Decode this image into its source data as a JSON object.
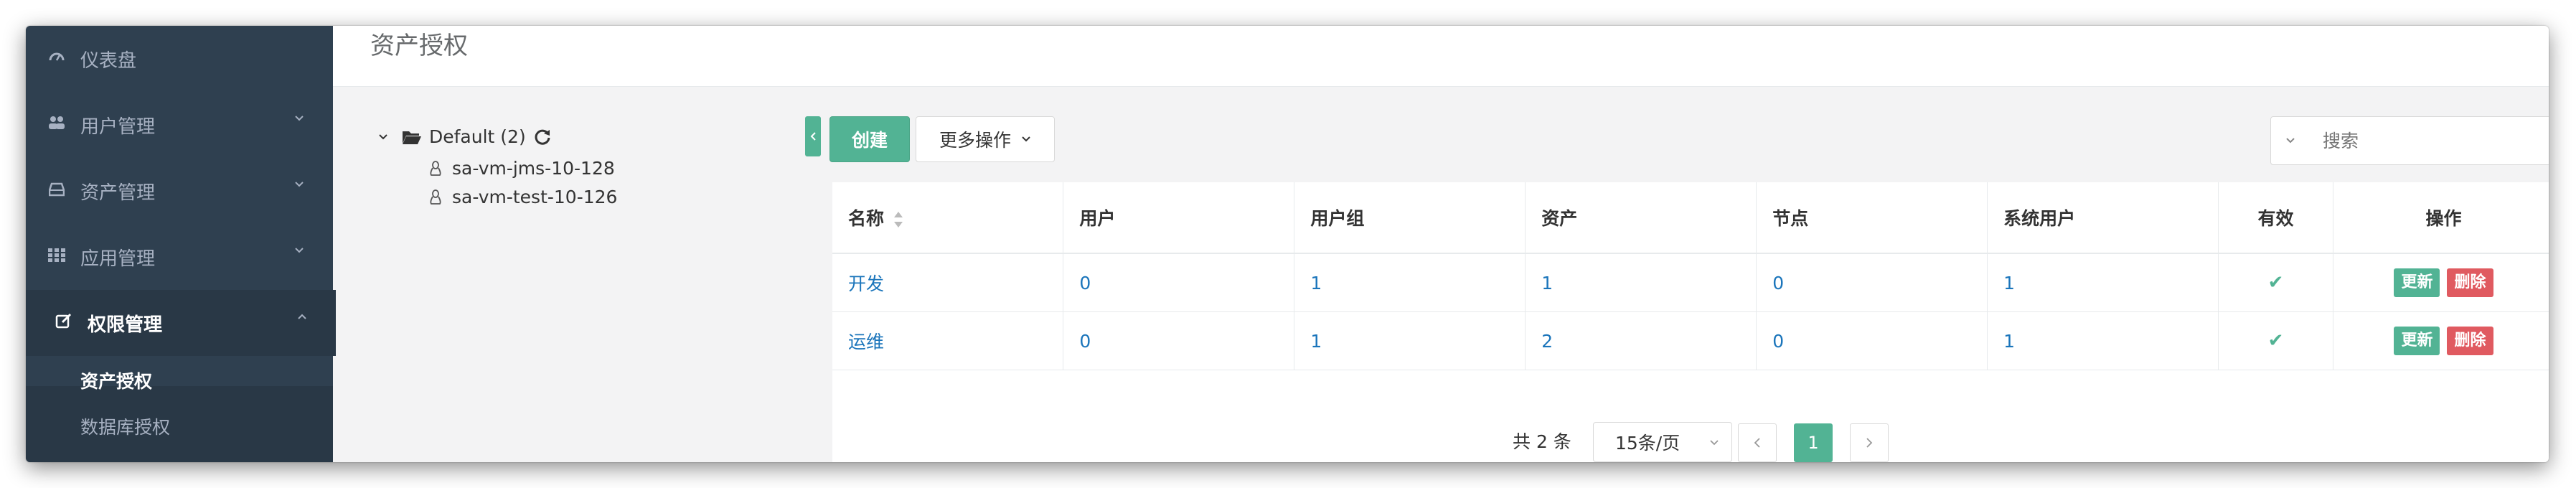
{
  "sidebar": {
    "items": [
      {
        "label": "仪表盘",
        "icon": "dashboard-icon"
      },
      {
        "label": "用户管理",
        "icon": "users-icon"
      },
      {
        "label": "资产管理",
        "icon": "inbox-icon"
      },
      {
        "label": "应用管理",
        "icon": "grid-icon"
      },
      {
        "label": "权限管理",
        "icon": "edit-icon"
      }
    ],
    "sub_items": [
      {
        "label": "资产授权"
      },
      {
        "label": "数据库授权"
      }
    ]
  },
  "header": {
    "title": "资产授权"
  },
  "tree": {
    "root": "Default (2)",
    "children": [
      "sa-vm-jms-10-128",
      "sa-vm-test-10-126"
    ]
  },
  "toolbar": {
    "create_label": "创建",
    "more_label": "更多操作",
    "search_placeholder": "搜索"
  },
  "table": {
    "columns": [
      "名称",
      "用户",
      "用户组",
      "资产",
      "节点",
      "系统用户",
      "有效",
      "操作"
    ],
    "rows": [
      {
        "name": "开发",
        "users": "0",
        "user_groups": "1",
        "assets": "1",
        "nodes": "0",
        "system_users": "1",
        "active": "✔",
        "update": "更新",
        "delete": "删除"
      },
      {
        "name": "运维",
        "users": "0",
        "user_groups": "1",
        "assets": "2",
        "nodes": "0",
        "system_users": "1",
        "active": "✔",
        "update": "更新",
        "delete": "删除"
      }
    ]
  },
  "pagination": {
    "total_text": "共 2 条",
    "page_size": "15条/页",
    "current_page": "1",
    "prev": "‹",
    "next": "›"
  },
  "colors": {
    "sidebar_bg": "#2f4050",
    "primary": "#52b394",
    "danger": "#e05a60",
    "link": "#1b75bb"
  }
}
